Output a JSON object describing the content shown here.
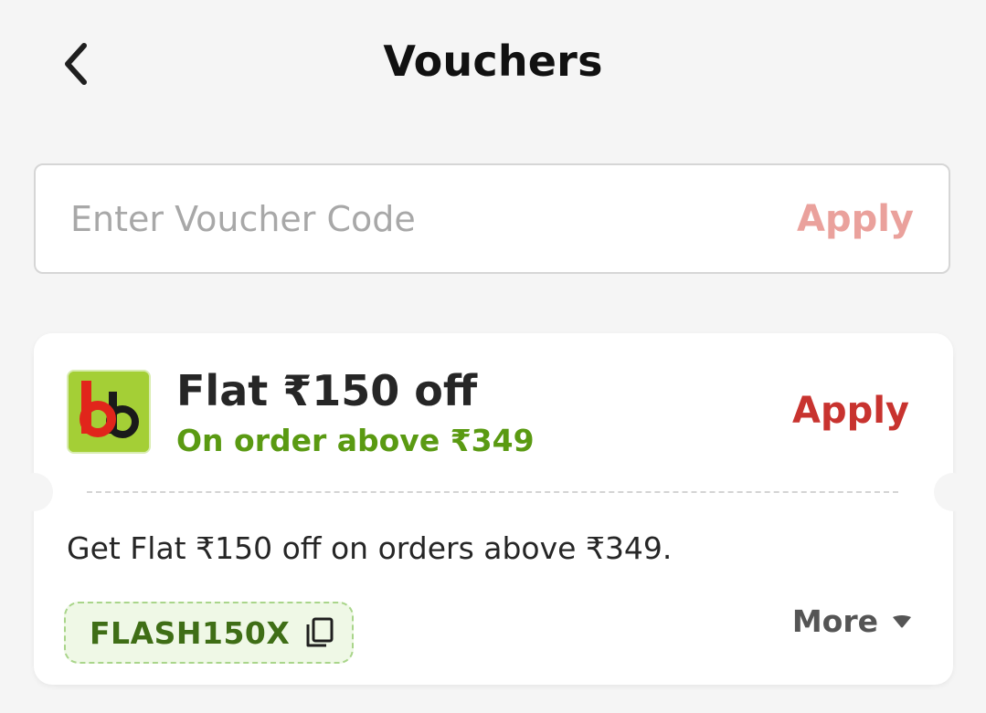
{
  "header": {
    "title": "Vouchers",
    "back_icon": "chevron-left-icon"
  },
  "voucher_input": {
    "placeholder": "Enter Voucher Code",
    "value": "",
    "apply_label": "Apply"
  },
  "voucher_card": {
    "logo_icon": "bigbasket-logo",
    "title": "Flat ₹150 off",
    "subtitle": "On order above ₹349",
    "apply_label": "Apply",
    "description": "Get Flat ₹150 off on orders above ₹349.",
    "code": "FLASH150X",
    "copy_icon": "copy-icon",
    "more_label": "More",
    "more_icon": "caret-down-icon"
  },
  "colors": {
    "background": "#f5f5f5",
    "apply_disabled": "#eaa19c",
    "apply_active": "#c8332f",
    "subtitle_green": "#5a9a12",
    "code_green": "#3f6e16",
    "chip_bg": "#eff8e6",
    "logo_green": "#a4cf36",
    "logo_red": "#e1251b"
  }
}
